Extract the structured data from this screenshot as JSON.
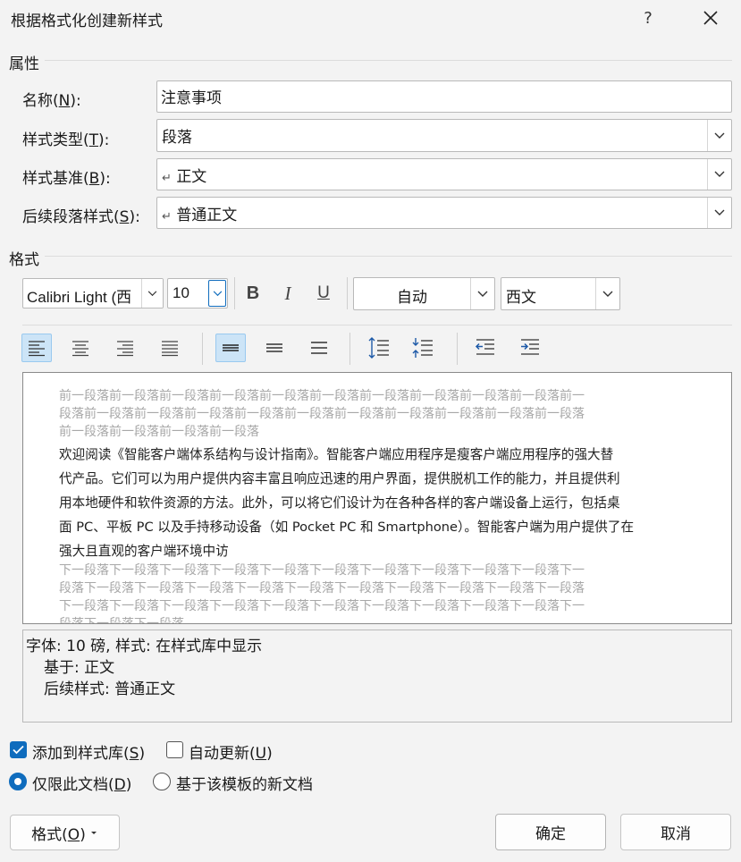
{
  "dialog": {
    "title": "根据格式化创建新样式",
    "help_glyph": "?"
  },
  "properties": {
    "section_label": "属性",
    "name_label": "名称(N):",
    "name_value": "注意事项",
    "type_label": "样式类型(T):",
    "type_value": "段落",
    "based_label": "样式基准(B):",
    "based_value": "正文",
    "next_label": "后续段落样式(S):",
    "next_value": "普通正文",
    "para_mark": "↵"
  },
  "format": {
    "section_label": "格式",
    "font_name": "Calibri Light (西",
    "font_size": "10",
    "bold": "B",
    "italic": "I",
    "underline": "U",
    "color_value": "自动",
    "script_value": "西文"
  },
  "preview": {
    "prev_lines": [
      "前一段落前一段落前一段落前一段落前一段落前一段落前一段落前一段落前一段落前一段落前一",
      "段落前一段落前一段落前一段落前一段落前一段落前一段落前一段落前一段落前一段落前一段落",
      "前一段落前一段落前一段落前一段落"
    ],
    "main_lines": [
      "欢迎阅读《智能客户端体系结构与设计指南》。智能客户端应用程序是瘦客户端应用程序的强大替",
      "代产品。它们可以为用户提供内容丰富且响应迅速的用户界面，提供脱机工作的能力，并且提供利",
      "用本地硬件和软件资源的方法。此外，可以将它们设计为在各种各样的客户端设备上运行，包括桌",
      "面 PC、平板 PC 以及手持移动设备（如 Pocket PC 和 Smartphone）。智能客户端为用户提供了在",
      "强大且直观的客户端环境中访"
    ],
    "next_lines": [
      "下一段落下一段落下一段落下一段落下一段落下一段落下一段落下一段落下一段落下一段落下一",
      "段落下一段落下一段落下一段落下一段落下一段落下一段落下一段落下一段落下一段落下一段落",
      "下一段落下一段落下一段落下一段落下一段落下一段落下一段落下一段落下一段落下一段落下一",
      "段落下一段落下一段落"
    ]
  },
  "description": {
    "line1": "字体: 10 磅, 样式: 在样式库中显示",
    "line2": "基于: 正文",
    "line3": "后续样式: 普通正文"
  },
  "options": {
    "add_to_gallery": "添加到样式库(S)",
    "add_to_gallery_checked": true,
    "auto_update": "自动更新(U)",
    "auto_update_checked": false,
    "only_this_doc": "仅限此文档(D)",
    "new_docs_template": "基于该模板的新文档"
  },
  "buttons": {
    "format": "格式(O)",
    "ok": "确定",
    "cancel": "取消"
  },
  "colors": {
    "accent": "#0f6cbd",
    "active_bg": "#cce4f7"
  }
}
